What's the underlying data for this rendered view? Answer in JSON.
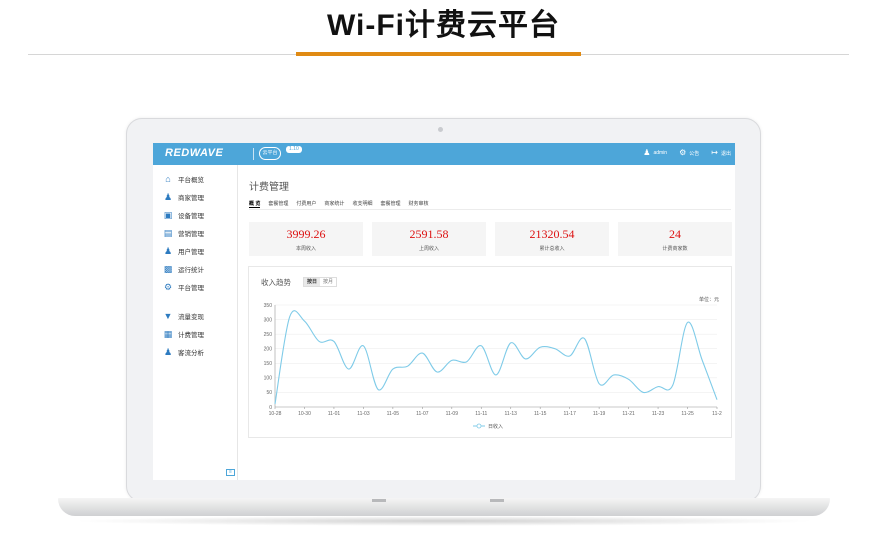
{
  "hero": {
    "title": "Wi-Fi计费云平台"
  },
  "app": {
    "logo": "REDWAVE",
    "cloud_logo": "云平台",
    "version": "1.10"
  },
  "topbar": {
    "user": "admin",
    "notice": "公告",
    "logout": "退出"
  },
  "sidebar": {
    "items": [
      {
        "label": "平台概览",
        "icon": "home-icon"
      },
      {
        "label": "商家管理",
        "icon": "merchant-icon"
      },
      {
        "label": "设备管理",
        "icon": "router-icon"
      },
      {
        "label": "营销管理",
        "icon": "document-icon"
      },
      {
        "label": "用户管理",
        "icon": "user-icon"
      },
      {
        "label": "运行统计",
        "icon": "bar-chart-icon"
      },
      {
        "label": "平台管理",
        "icon": "gear-icon"
      },
      {
        "label": "流量变现",
        "icon": "funnel-icon"
      },
      {
        "label": "计费管理",
        "icon": "billing-icon"
      },
      {
        "label": "客流分析",
        "icon": "users-icon"
      }
    ]
  },
  "main": {
    "title": "计费管理",
    "tabs": [
      "概 览",
      "套餐管理",
      "付费用户",
      "商家统计",
      "收支明细",
      "套餐管理",
      "财务审核"
    ],
    "active_tab": 0,
    "stats": [
      {
        "value": "3999.26",
        "label": "本周收入"
      },
      {
        "value": "2591.58",
        "label": "上周收入"
      },
      {
        "value": "21320.54",
        "label": "累计总收入"
      },
      {
        "value": "24",
        "label": "计费商家数"
      }
    ],
    "chart": {
      "title": "收入趋势",
      "seg_on": "按日",
      "seg_off": "按月",
      "unit": "单位：元",
      "legend": "日收入"
    }
  },
  "colors": {
    "topbar": "#4da6d9",
    "accent": "#e08a13",
    "stat_value": "#dd1111",
    "line": "#7fcbe8"
  },
  "chart_data": {
    "type": "line",
    "title": "收入趋势",
    "xlabel": "",
    "ylabel": "",
    "ylim": [
      0,
      350
    ],
    "yticks": [
      0,
      50,
      100,
      150,
      200,
      250,
      300,
      350
    ],
    "xticks": [
      "10-28",
      "10-30",
      "11-01",
      "11-03",
      "11-05",
      "11-07",
      "11-09",
      "11-11",
      "11-13",
      "11-15",
      "11-17",
      "11-19",
      "11-21",
      "11-23",
      "11-25",
      "11-2"
    ],
    "legend": "top-none-bottom-center",
    "grid": true,
    "series": [
      {
        "name": "日收入",
        "x": [
          "10-28",
          "10-29",
          "10-30",
          "10-31",
          "11-01",
          "11-02",
          "11-03",
          "11-04",
          "11-05",
          "11-06",
          "11-07",
          "11-08",
          "11-09",
          "11-10",
          "11-11",
          "11-12",
          "11-13",
          "11-14",
          "11-15",
          "11-16",
          "11-17",
          "11-18",
          "11-19",
          "11-20",
          "11-21",
          "11-22",
          "11-23",
          "11-24",
          "11-25",
          "11-26",
          "11-27"
        ],
        "values": [
          10,
          310,
          295,
          225,
          225,
          130,
          210,
          60,
          130,
          140,
          185,
          120,
          160,
          155,
          210,
          110,
          220,
          165,
          205,
          200,
          175,
          235,
          80,
          110,
          95,
          50,
          70,
          75,
          290,
          160,
          25
        ]
      }
    ]
  }
}
